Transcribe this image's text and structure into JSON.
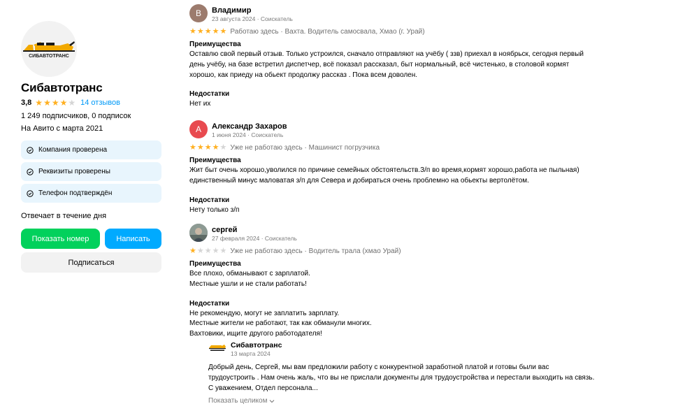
{
  "company": {
    "name": "Сибавтотранс",
    "logo_text": "СИБАВТОТРАНС",
    "rating": "3,8",
    "stars": 4,
    "reviews_link": "14 отзывов",
    "subscribers": "1 249 подписчиков, 0 подписок",
    "since": "На Авито с марта 2021",
    "badges": [
      {
        "label": "Компания проверена",
        "icon": "check-circle-icon"
      },
      {
        "label": "Реквизиты проверены",
        "icon": "check-circle-icon"
      },
      {
        "label": "Телефон подтверждён",
        "icon": "check-circle-icon"
      }
    ],
    "response_time": "Отвечает в течение дня",
    "buttons": {
      "show_number": "Показать номер",
      "write": "Написать",
      "subscribe": "Подписаться"
    }
  },
  "colors": {
    "star_on": "#ffb021",
    "star_off": "#d5d5d5",
    "link": "#0099f7",
    "green_button": "#02d15c",
    "blue_button": "#00aaff",
    "badge_bg": "#e8f5fd"
  },
  "reviews": [
    {
      "author": "Владимир",
      "avatar_letter": "В",
      "avatar_color": "#9c7b6d",
      "date": "23 августа 2024 · Соискатель",
      "stars": 5,
      "tagline": "Работаю здесь · Вахта. Водитель самосвала, Хмао (г. Урай)",
      "pros_title": "Преимущества",
      "pros": [
        "Оставлю свой первый отзыв. Только устроился, сначало отправляют на учёбу ( ззв) приехал в ноябрьск, сегодня первый",
        "день учёбу, на базе встретил диспетчер, всё показал рассказал, быт нормальный, всё чистенько, в столовой кормят",
        "хорошо, как приеду на обьект продолжу рассказ . Пока всем доволен."
      ],
      "cons_title": "Недостатки",
      "cons": [
        "Нет их"
      ]
    },
    {
      "author": "Александр Захаров",
      "avatar_letter": "А",
      "avatar_color": "#e84a4f",
      "date": "1 июня 2024 · Соискатель",
      "stars": 4,
      "tagline": "Уже не работаю здесь · Машинист погрузчика",
      "pros_title": "Преимущества",
      "pros": [
        "Жит быт очень хорошо,уволился по причине семейных обстоятельств.З/п во время,кормят хорошо,работа не пыльная)",
        "единственный минус маловатая з/п для Севера и добираться очень проблемно на обьекты вертолётом."
      ],
      "cons_title": "Недостатки",
      "cons": [
        "Нету только з/п"
      ]
    },
    {
      "author": "сергей",
      "avatar_letter": "",
      "avatar_color": "#7f8c8d",
      "date": "27 февраля 2024 · Соискатель",
      "stars": 1,
      "tagline": "Уже не работаю здесь · Водитель трала (хмао Урай)",
      "pros_title": "Преимущества",
      "pros": [
        "Все плохо, обманывают с зарплатой.",
        "Местные ушли и не стали работать!"
      ],
      "cons_title": "Недостатки",
      "cons": [
        "Не рекомендую, могут не заплатить зарплату.",
        "Местные жители не работают, так как обманули многих.",
        "Вахтовики, ищите другого работодателя!"
      ],
      "reply": {
        "name": "Сибавтотранс",
        "date": "13 марта 2024",
        "text": [
          "Добрый день, Сергей, мы вам предложили работу с конкурентной заработной платой и готовы были вас",
          "трудоустроить . Нам очень жаль, что вы не прислали документы для трудоустройства и перестали выходить на связь.",
          "С уважением, Отдел персонала..."
        ],
        "show_more": "Показать целиком"
      }
    }
  ]
}
